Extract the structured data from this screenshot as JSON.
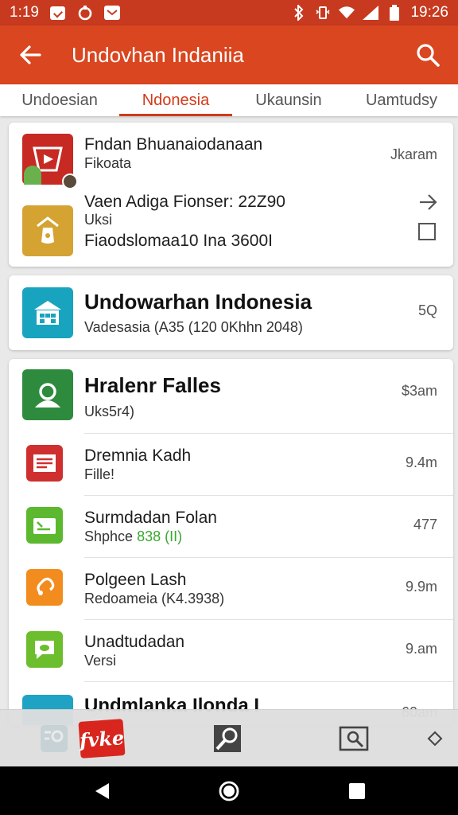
{
  "status_bar": {
    "time_left": "1:19",
    "time_right": "19:26"
  },
  "app_bar": {
    "title": "Undovhan Indaniia"
  },
  "tabs": [
    {
      "label": "Undoesian"
    },
    {
      "label": "Ndonesia",
      "active": true
    },
    {
      "label": "Ukaunsin"
    },
    {
      "label": "Uamtudsy"
    }
  ],
  "card1": {
    "row1": {
      "title": "Fndan Bhuanaiodanaan",
      "subtitle": "Fikoata",
      "right": "Jkaram"
    },
    "row2": {
      "title": "Vaen Adiga Fionser: 22Z90",
      "line2": "Uksi",
      "line3": "Fiaodslomaa10 Ina 3600I"
    }
  },
  "card2": {
    "title": "Undowarhan Indonesia",
    "subtitle": "Vadesasia (A35 (120 0Khhn 2048)",
    "right": "5Q"
  },
  "list": [
    {
      "title": "Hralenr Falles",
      "subtitle": "Uks5r4)",
      "right": "$3am",
      "big": true,
      "color": "#2e8b3e",
      "icon": "people-icon"
    },
    {
      "title": "Dremnia Kadh",
      "subtitle": "Fille!",
      "right": "9.4m",
      "color": "#cf2f2f",
      "icon": "document-icon"
    },
    {
      "title": "Surmdadan Folan",
      "subtitle": "Shphce ",
      "subtitle_accent": "838 (II)",
      "right": "477",
      "color": "#5cb82e",
      "icon": "card-icon"
    },
    {
      "title": "Polgeen Lash",
      "subtitle": "Redoameia (K4.3938)",
      "right": "9.9m",
      "color": "#f28c1e",
      "icon": "link-icon"
    },
    {
      "title": "Unadtudadan",
      "subtitle": "Versi",
      "right": "9.am",
      "color": "#6cbe2c",
      "icon": "chat-icon"
    },
    {
      "title": "Undmlanka Ilonda I",
      "subtitle": "",
      "right": "60am",
      "color": "#1fa3c4",
      "icon": "apps-icon"
    }
  ],
  "bottom_bar": {
    "logo_text": "fvke"
  },
  "colors": {
    "primary": "#d9461f",
    "status": "#c73a1f",
    "accent": "#d23b1a"
  }
}
